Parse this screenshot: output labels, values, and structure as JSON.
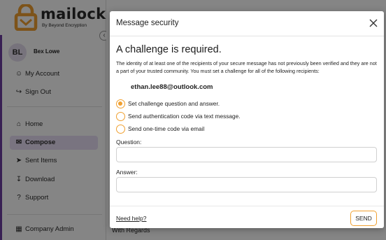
{
  "app": {
    "brand": "mailock",
    "tagline": "By Beyond Encryption",
    "user": {
      "initials": "BL",
      "name": "Bex Lowe"
    },
    "nav": {
      "my_account": "My Account",
      "sign_out": "Sign Out",
      "home": "Home",
      "compose": "Compose",
      "sent_items": "Sent Items",
      "download": "Download",
      "support": "Support",
      "company_admin": "Company Admin"
    },
    "background_text": "With Regards",
    "colors": {
      "accent": "#f0a030",
      "brand_purple": "#6b3fa0",
      "active_nav": "#e8def5"
    }
  },
  "modal": {
    "title": "Message security",
    "heading": "A challenge is required.",
    "description": "The identity of at least one of the recipients of your secure message has not previously been verified and they are not a part of your trusted community. You must set a challenge for all of the following recipients:",
    "recipient": "ethan.lee88@outlook.com",
    "options": [
      {
        "label": "Set challenge question and answer.",
        "selected": true
      },
      {
        "label": "Send authentication code via text message.",
        "selected": false
      },
      {
        "label": "Send one-time code via email",
        "selected": false
      }
    ],
    "question_label": "Question:",
    "question_value": "",
    "answer_label": "Answer:",
    "answer_value": "",
    "help_link": "Need help?",
    "send_label": "SEND"
  }
}
